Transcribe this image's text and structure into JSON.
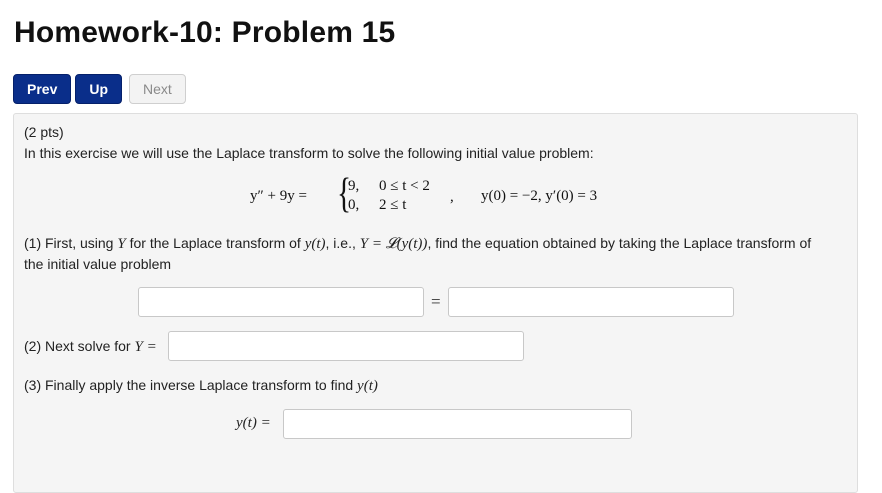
{
  "page": {
    "title": "Homework-10: Problem 15"
  },
  "nav": {
    "prev": "Prev",
    "up": "Up",
    "next": "Next"
  },
  "problem": {
    "points": "(2 pts)",
    "intro": "In this exercise we will use the Laplace transform to solve the following initial value problem:",
    "equation": {
      "lhs": "y″ + 9y =",
      "case1_value": "9,",
      "case1_cond": "0 ≤ t < 2",
      "case2_value": "0,",
      "case2_cond": "2 ≤ t",
      "separator": ",",
      "initial_conditions": "y(0) = −2, y′(0) = 3"
    },
    "part1": {
      "text_a": "(1) First, using ",
      "var_Y": "Y",
      "text_b": " for the Laplace transform of ",
      "var_y": "y(t)",
      "text_c": ", i.e., ",
      "expr": "Y = 𝓛(y(t))",
      "text_d": ", find the equation obtained by taking the Laplace transform of",
      "text_e": "the initial value problem",
      "equals": "="
    },
    "part2": {
      "text": "(2) Next solve for ",
      "expr": "Y ="
    },
    "part3": {
      "text": "(3) Finally apply the inverse Laplace transform to find ",
      "var": "y(t)",
      "answer_label": "y(t) ="
    }
  }
}
